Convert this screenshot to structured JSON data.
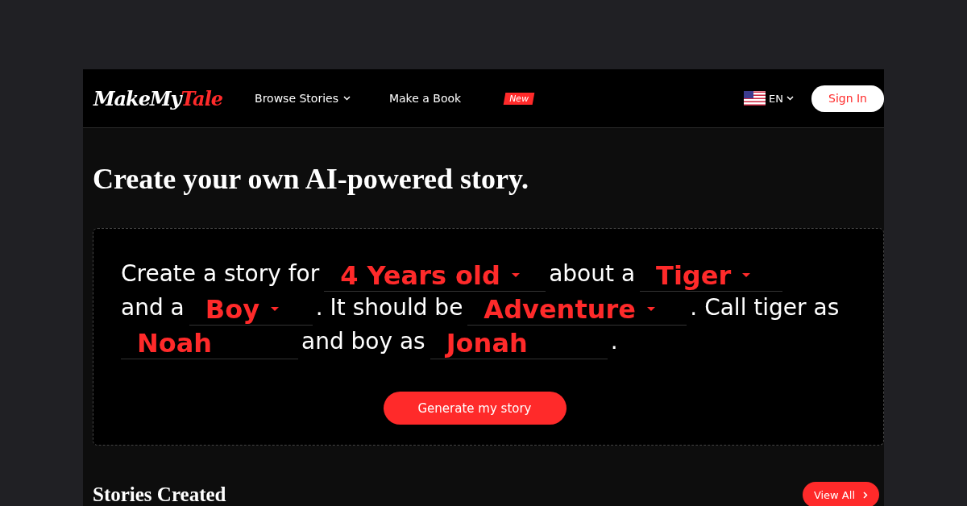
{
  "header": {
    "logo": {
      "part_1": "MakeMy",
      "part_2": "Tale"
    },
    "nav": [
      {
        "label": "Browse Stories",
        "kind": "dropdown"
      },
      {
        "label": "Make a Book",
        "kind": "badge",
        "badge": "New"
      }
    ],
    "language": "EN",
    "sign_in": "Sign In"
  },
  "title": "Create your own AI-powered story.",
  "story": {
    "lines": [
      [
        {
          "kind": "text",
          "text": "Create a story for"
        },
        {
          "kind": "select",
          "value": "4 Years old"
        },
        {
          "kind": "text",
          "text": "about a"
        },
        {
          "kind": "select",
          "value": "Tiger"
        }
      ],
      [
        {
          "kind": "text",
          "text": "and a"
        },
        {
          "kind": "select",
          "value": "Boy"
        },
        {
          "kind": "text",
          "text": ". It should be"
        },
        {
          "kind": "select",
          "value": "Adventure"
        },
        {
          "kind": "text",
          "text": ". Call tiger as"
        }
      ],
      [
        {
          "kind": "input",
          "value": "Noah"
        },
        {
          "kind": "text",
          "text": "and boy as"
        },
        {
          "kind": "input",
          "value": "Jonah"
        },
        {
          "kind": "text",
          "text": "."
        }
      ]
    ],
    "button": "Generate my story"
  },
  "section": {
    "title": "Stories Created",
    "button": "View All"
  }
}
